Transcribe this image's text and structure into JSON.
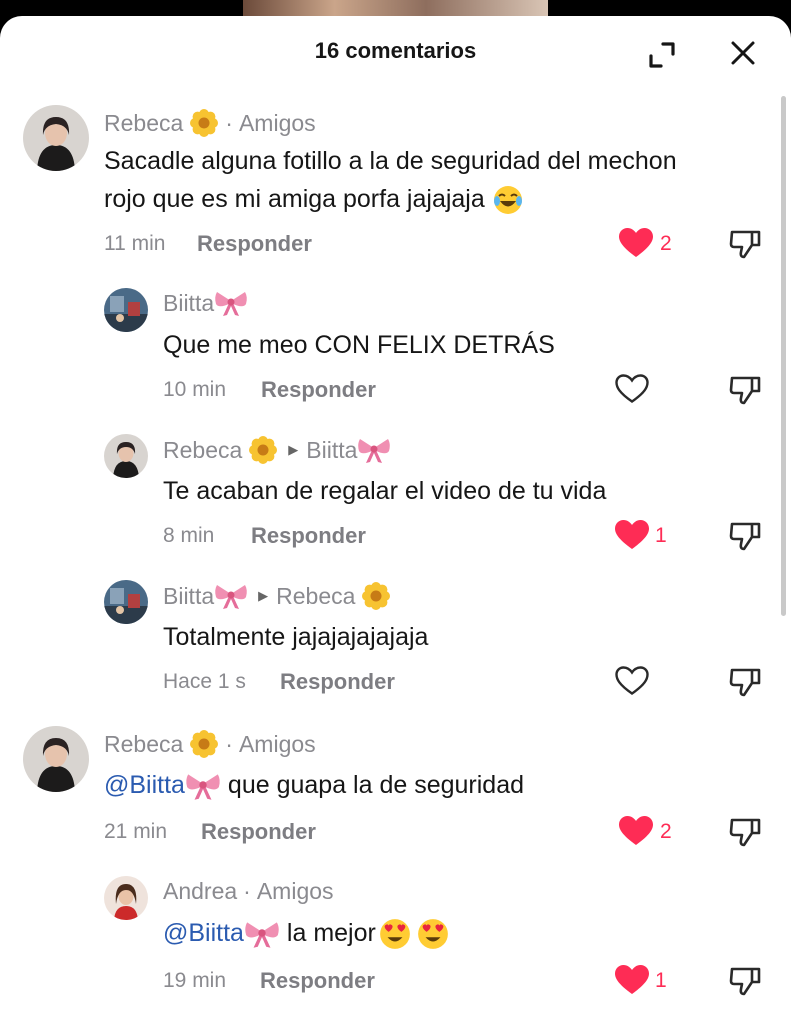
{
  "header": {
    "title": "16 comentarios"
  },
  "reply_label": "Responder",
  "colors": {
    "like_red": "#fe2c55",
    "mention_blue": "#2b5bb0",
    "meta_gray": "#8a8a8f"
  },
  "comments": [
    {
      "author": "Rebeca",
      "author_emoji": "flower-emoji",
      "tag": "Amigos",
      "text": "Sacadle alguna fotillo a la de seguridad del mechon rojo que es mi amiga porfa jajajaja",
      "text_emoji": "joy-emoji",
      "time": "11 min",
      "liked": true,
      "likes": "2"
    },
    {
      "author": "Biitta",
      "author_emoji": "ribbon-emoji",
      "text": "Que me meo CON FELIX DETRÁS",
      "time": "10 min",
      "liked": false
    },
    {
      "author": "Rebeca",
      "author_emoji": "flower-emoji",
      "reply_to": "Biitta",
      "reply_to_emoji": "ribbon-emoji",
      "text": "Te acaban de regalar el video de tu vida",
      "time": "8 min",
      "liked": true,
      "likes": "1"
    },
    {
      "author": "Biitta",
      "author_emoji": "ribbon-emoji",
      "reply_to": "Rebeca",
      "reply_to_emoji": "flower-emoji",
      "text": "Totalmente jajajajajajaja",
      "time": "Hace 1 s",
      "liked": false
    },
    {
      "author": "Rebeca",
      "author_emoji": "flower-emoji",
      "tag": "Amigos",
      "mention": "@Biitta",
      "mention_emoji": "ribbon-emoji",
      "text": "que guapa la de seguridad",
      "time": "21 min",
      "liked": true,
      "likes": "2"
    },
    {
      "author": "Andrea",
      "tag": "Amigos",
      "mention": "@Biitta",
      "mention_emoji": "ribbon-emoji",
      "text": "la mejor",
      "text_emoji": "heart-eyes-emoji",
      "time": "19 min",
      "liked": true,
      "likes": "1"
    }
  ]
}
